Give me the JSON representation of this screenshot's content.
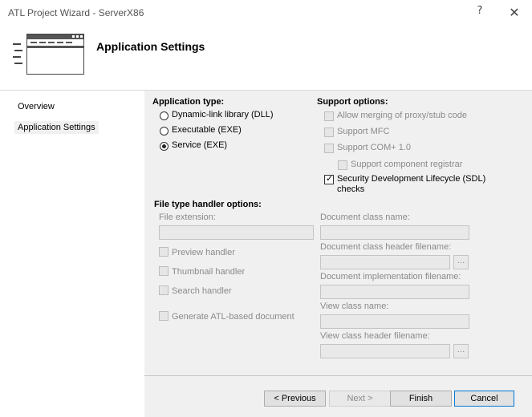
{
  "window": {
    "title": "ATL Project Wizard - ServerX86",
    "help_glyph": "?",
    "close_glyph": "✕"
  },
  "header": {
    "title": "Application Settings",
    "logo_icon": "wizard-window-icon"
  },
  "nav": {
    "items": [
      {
        "label": "Overview",
        "selected": false
      },
      {
        "label": "Application Settings",
        "selected": true
      }
    ]
  },
  "application_type": {
    "label": "Application type:",
    "options": [
      {
        "label": "Dynamic-link library (DLL)",
        "checked": false
      },
      {
        "label": "Executable (EXE)",
        "checked": false
      },
      {
        "label": "Service (EXE)",
        "checked": true
      }
    ]
  },
  "support_options": {
    "label": "Support options:",
    "options": [
      {
        "label": "Allow merging of proxy/stub code",
        "checked": false,
        "enabled": false
      },
      {
        "label": "Support MFC",
        "checked": false,
        "enabled": false
      },
      {
        "label": "Support COM+ 1.0",
        "checked": false,
        "enabled": false
      },
      {
        "label": "Support component registrar",
        "checked": false,
        "enabled": false
      },
      {
        "label": "Security Development Lifecycle (SDL)",
        "label_line2": "checks",
        "checked": true,
        "enabled": true
      }
    ]
  },
  "file_type_handler": {
    "label": "File type handler options:",
    "file_extension_label": "File extension:",
    "file_extension_value": "",
    "handlers": [
      {
        "label": "Preview handler",
        "checked": false
      },
      {
        "label": "Thumbnail handler",
        "checked": false
      },
      {
        "label": "Search handler",
        "checked": false
      },
      {
        "label": "Generate ATL-based document",
        "checked": false
      }
    ],
    "fields": {
      "document_class_name": {
        "label": "Document class name:",
        "value": ""
      },
      "document_class_header": {
        "label": "Document class header filename:",
        "value": ""
      },
      "document_impl": {
        "label": "Document implementation filename:",
        "value": ""
      },
      "view_class_name": {
        "label": "View class name:",
        "value": ""
      },
      "view_class_header": {
        "label": "View class header filename:",
        "value": ""
      }
    },
    "browse_label": "..."
  },
  "buttons": {
    "previous": "< Previous",
    "next": "Next >",
    "finish": "Finish",
    "cancel": "Cancel"
  },
  "colors": {
    "content_bg": "#f0f0f0",
    "disabled_text": "#8a8a8a",
    "default_button_border": "#0078d7"
  }
}
